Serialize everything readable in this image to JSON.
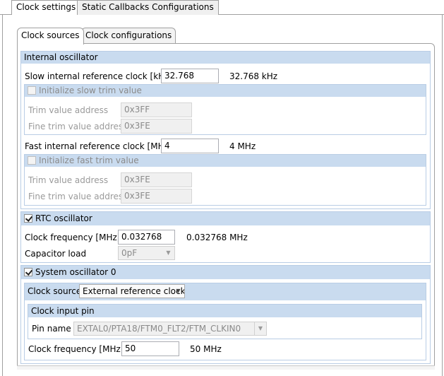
{
  "outer_tabs": [
    "Clock settings",
    "Static Callbacks Configurations"
  ],
  "inner_tabs": [
    "Clock sources",
    "Clock configurations"
  ],
  "internal_osc": {
    "title": "Internal oscillator",
    "slow_label": "Slow internal reference clock [kHz]",
    "slow_value": "32.768",
    "slow_readout": "32.768 kHz",
    "slow_trim": {
      "checkbox_label": "Initialize slow trim value",
      "checked": false,
      "trim_addr_label": "Trim value address",
      "trim_addr_value": "0x3FF",
      "fine_addr_label": "Fine trim value address",
      "fine_addr_value": "0x3FE"
    },
    "fast_label": "Fast internal reference clock [MHz]",
    "fast_value": "4",
    "fast_readout": "4 MHz",
    "fast_trim": {
      "checkbox_label": "Initialize fast trim value",
      "checked": false,
      "trim_addr_label": "Trim value address",
      "trim_addr_value": "0x3FE",
      "fine_addr_label": "Fine trim value address",
      "fine_addr_value": "0x3FE"
    }
  },
  "rtc_osc": {
    "title": "RTC oscillator",
    "checked": true,
    "freq_label": "Clock frequency [MHz]",
    "freq_value": "0.032768",
    "freq_readout": "0.032768 MHz",
    "cap_label": "Capacitor load",
    "cap_value": "0pF"
  },
  "sys_osc": {
    "title": "System oscillator 0",
    "checked": true,
    "source_label": "Clock source",
    "source_value": "External reference clock",
    "input_pin": {
      "title": "Clock input pin",
      "pin_label": "Pin name",
      "pin_value": "EXTAL0/PTA18/FTM0_FLT2/FTM_CLKIN0"
    },
    "freq_label": "Clock frequency [MHz]",
    "freq_value": "50",
    "freq_readout": "50 MHz"
  }
}
